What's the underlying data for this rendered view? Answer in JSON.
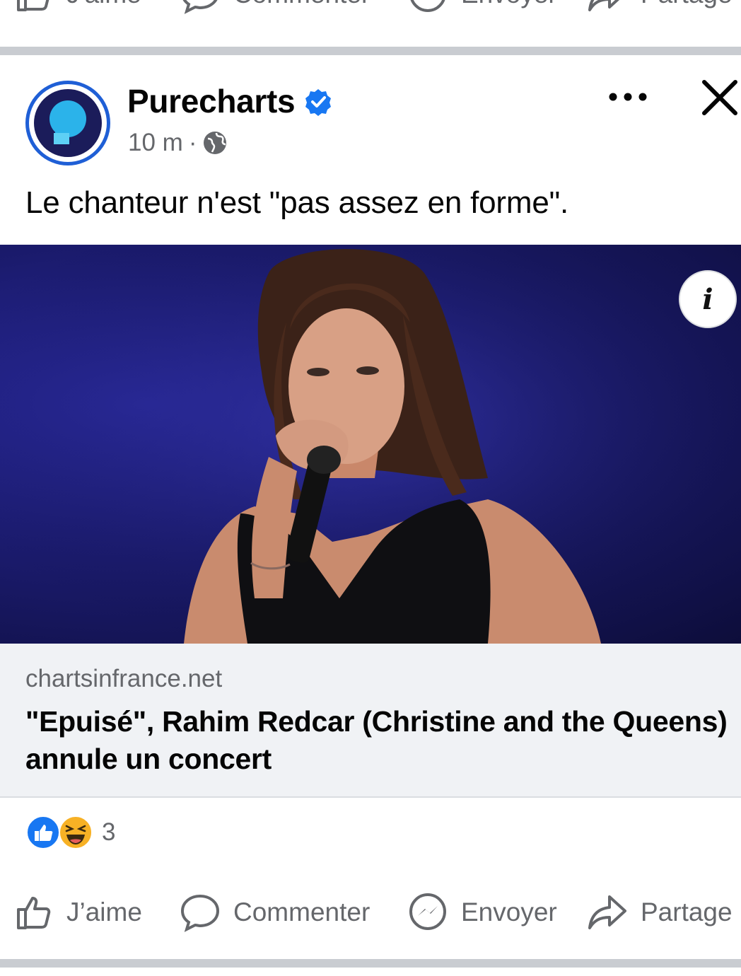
{
  "top_actions": {
    "like_label": "J'aime",
    "comment_label": "Commenter",
    "send_label": "Envoyer",
    "share_label": "Partage"
  },
  "post": {
    "page_name": "Purecharts",
    "time": "10 m",
    "separator": "·",
    "caption": "Le chanteur n'est \"pas assez en forme\".",
    "info_glyph": "i",
    "link": {
      "domain": "chartsinfrance.net",
      "title": "\"Epuisé\", Rahim Redcar (Christine and the Queens) annule un concert"
    },
    "reaction_count": "3",
    "actions": {
      "like_label": "J’aime",
      "comment_label": "Commenter",
      "send_label": "Envoyer",
      "share_label": "Partage"
    }
  },
  "icons": {
    "verified": "verified-badge-icon",
    "globe": "globe-icon",
    "more": "more-options-icon",
    "close": "close-icon",
    "like": "thumbs-up-icon",
    "comment": "comment-icon",
    "send": "messenger-icon",
    "share": "share-icon",
    "reaction_like": "like-reaction-icon",
    "reaction_haha": "haha-reaction-icon"
  },
  "colors": {
    "accent": "#1877f2",
    "separator": "#c9ccd1",
    "link_box": "#f0f2f5",
    "muted_text": "#65676b",
    "stage_background": "#1b1b6e"
  }
}
